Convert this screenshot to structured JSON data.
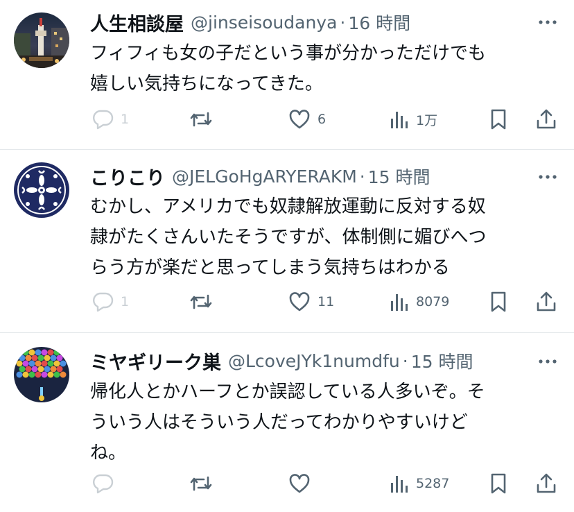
{
  "posts": [
    {
      "author_name": "人生相談屋",
      "handle": "@jinseisoudanya",
      "separator": "·",
      "time": "16 時間",
      "text_lines": [
        "フィフィも女の子だという事が分かっただけでも",
        "嬉しい気持ちになってきた。"
      ],
      "reply_count": "1",
      "repost_count": "",
      "like_count": "6",
      "view_count": "1万",
      "avatar_icon": "kyoto-tower-night-avatar"
    },
    {
      "author_name": "こりこり",
      "handle": "@JELGoHgARYERAKM",
      "separator": "·",
      "time": "15 時間",
      "text_lines": [
        "むかし、アメリカでも奴隷解放運動に反対する奴",
        "隷がたくさんいたそうですが、体制側に媚びへつ",
        "らう方が楽だと思ってしまう気持ちはわかる"
      ],
      "reply_count": "1",
      "repost_count": "",
      "like_count": "11",
      "view_count": "8079",
      "avatar_icon": "navy-floral-pattern-avatar"
    },
    {
      "author_name": "ミヤギリーク巣",
      "handle": "@LcoveJYk1numdfu",
      "separator": "·",
      "time": "15 時間",
      "text_lines": [
        "帰化人とかハーフとか誤認している人多いぞ。そ",
        "ういう人はそういう人だってわかりやすいけど",
        "ね。"
      ],
      "reply_count": "",
      "repost_count": "",
      "like_count": "",
      "view_count": "5287",
      "avatar_icon": "bubble-shooter-avatar"
    }
  ],
  "colors": {
    "text": "#0f1419",
    "secondary": "#536471",
    "faint": "#c9cfd4",
    "divider": "#e4e8eb"
  },
  "icons": [
    "more-icon",
    "reply-icon",
    "repost-icon",
    "like-icon",
    "views-icon",
    "bookmark-icon",
    "share-icon"
  ]
}
